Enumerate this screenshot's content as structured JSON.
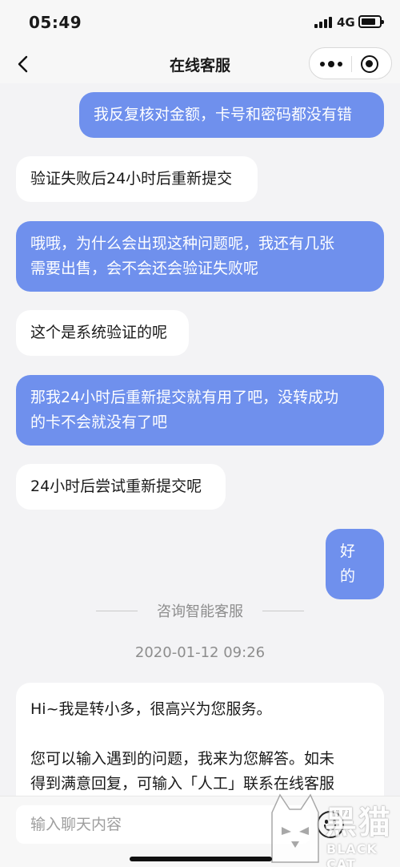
{
  "status_bar": {
    "time": "05:49",
    "network": "4G"
  },
  "nav": {
    "title": "在线客服"
  },
  "messages": [
    {
      "from": "user",
      "lines": [
        "我反复核对金额，卡号和密码都没有错"
      ]
    },
    {
      "from": "agent",
      "lines": [
        "验证失败后24小时后重新提交"
      ]
    },
    {
      "from": "user",
      "lines": [
        "哦哦，为什么会出现这种问题呢，我还有几张",
        "需要出售，会不会还会验证失败呢"
      ]
    },
    {
      "from": "agent",
      "lines": [
        "这个是系统验证的呢"
      ]
    },
    {
      "from": "user",
      "lines": [
        "那我24小时后重新提交就有用了吧，没转成功",
        "的卡不会就没有了吧"
      ]
    },
    {
      "from": "agent",
      "lines": [
        "24小时后尝试重新提交呢"
      ]
    },
    {
      "from": "user",
      "lines": [
        "好的"
      ]
    }
  ],
  "session_divider": "咨询智能客服",
  "timestamp": "2020-01-12 09:26",
  "welcome": {
    "line1": "Hi~我是转小多，很高兴为您服务。",
    "line2": "您可以输入遇到的问题，我来为您解答。如未",
    "line3": "得到满意回复，可输入「人工」联系在线客服"
  },
  "input": {
    "placeholder": "输入聊天内容"
  },
  "watermark": {
    "logo_text": "黑猫",
    "sub_text": "BLACK CAT"
  },
  "icons": {
    "back": "chevron-left-icon",
    "more": "more-dots-icon",
    "close": "target-circle-icon",
    "emoji": "smiley-face-icon"
  },
  "colors": {
    "user_bubble": "#6f90ed",
    "agent_bubble": "#ffffff",
    "background": "#f3f3f5"
  }
}
